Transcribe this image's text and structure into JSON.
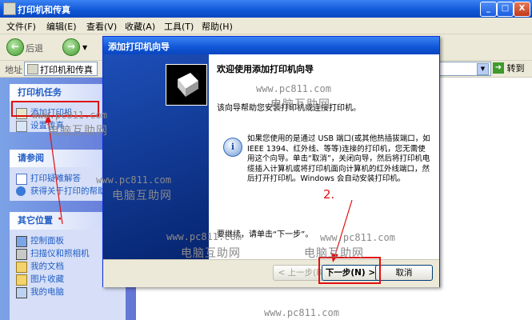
{
  "window": {
    "title": "打印机和传真",
    "caption_buttons": [
      "_",
      "□",
      "X"
    ]
  },
  "menubar": [
    "文件(F)",
    "编辑(E)",
    "查看(V)",
    "收藏(A)",
    "工具(T)",
    "帮助(H)"
  ],
  "toolbar": {
    "back_label": "后退"
  },
  "address": {
    "label": "地址",
    "value": "打印机和传真",
    "go_label": "转到"
  },
  "tasks": {
    "printer_tasks": {
      "title": "打印机任务",
      "items": [
        "添加打印机",
        "设置传真"
      ]
    },
    "see_also": {
      "title": "请参阅",
      "items": [
        "打印疑难解答",
        "获得关于打印的帮助"
      ]
    },
    "other_places": {
      "title": "其它位置",
      "items": [
        "控制面板",
        "扫描仪和照相机",
        "我的文档",
        "图片收藏",
        "我的电脑"
      ]
    }
  },
  "wizard": {
    "title": "添加打印机向导",
    "heading": "欢迎使用添加打印机向导",
    "intro": "该向导帮助您安装打印机或连接打印机。",
    "info": "如果您使用的是通过 USB 端口(或其他热插拔端口，如 IEEE 1394、红外线、等等)连接的打印机，您无需使用这个向导。单击“取消”，关闭向导，然后将打印机电缆插入计算机或将打印机面向计算机的红外线端口，然后打开打印机。Windows 会自动安装打印机。",
    "continue": "要继续，请单击“下一步”。",
    "buttons": {
      "back": "< 上一步(B)",
      "next": "下一步(N) >",
      "cancel": "取消"
    }
  },
  "annotations": {
    "step2": "2."
  },
  "watermarks": {
    "site": "www.pc811.com",
    "name": "电脑互助网"
  },
  "colors": {
    "titlebar": "#0f56d6",
    "task_link": "#215dc6",
    "highlight_box": "#e01010"
  }
}
